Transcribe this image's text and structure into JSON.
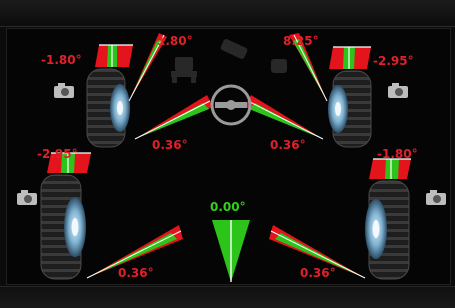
{
  "readings": {
    "front_left_camber": "-1.80°",
    "front_left_toe": "1.80°",
    "front_right_toe": "8.25°",
    "front_right_camber": "-2.95°",
    "front_left_toe_lower": "0.36°",
    "front_right_toe_lower": "0.36°",
    "rear_left_camber": "-2.95°",
    "rear_right_camber": "-1.80°",
    "thrust_angle": "0.00°",
    "rear_left_toe": "0.36°",
    "rear_right_toe": "0.36°"
  },
  "icons": {
    "camera": "camera-icon",
    "steering": "steering-wheel-icon",
    "vehicle_front": "vehicle-front-icon",
    "tool": "wrench-icon"
  },
  "colors": {
    "value_red": "#e0202a",
    "value_green": "#33d11a",
    "background": "#050505",
    "gauge_red": "#e3141c",
    "gauge_green": "#2cc41a"
  }
}
